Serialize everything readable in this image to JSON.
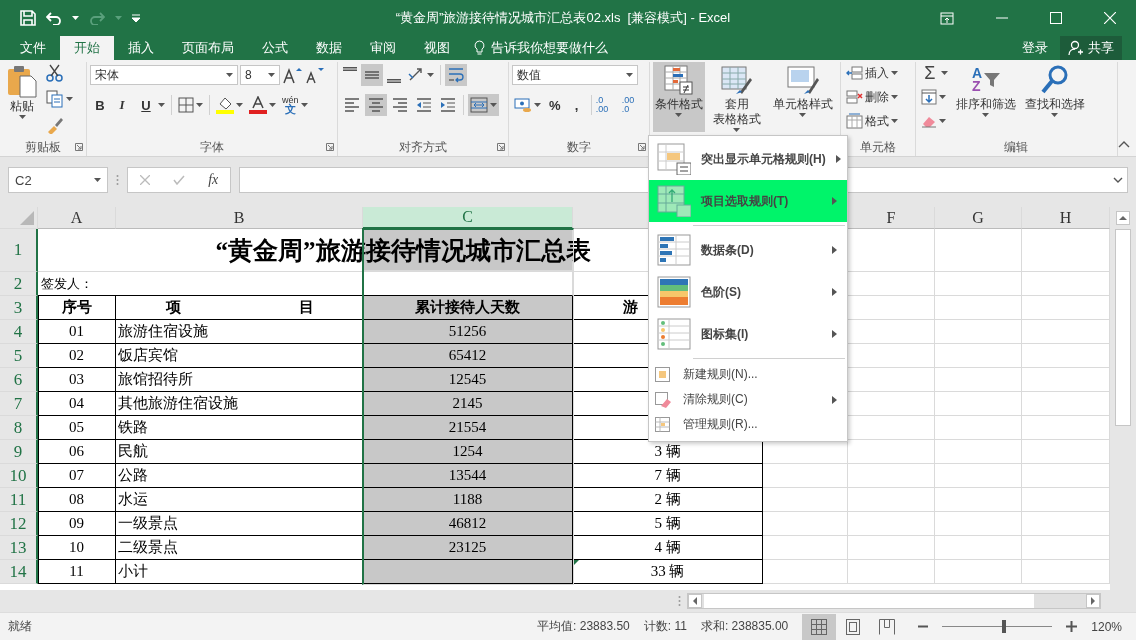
{
  "title_bar": {
    "title": "“黄金周”旅游接待情况城市汇总表02.xls  [兼容模式] - Excel",
    "redo_disabled": true
  },
  "tabs": [
    {
      "label": "文件",
      "selected": false
    },
    {
      "label": "开始",
      "selected": true
    },
    {
      "label": "插入",
      "selected": false
    },
    {
      "label": "页面布局",
      "selected": false
    },
    {
      "label": "公式",
      "selected": false
    },
    {
      "label": "数据",
      "selected": false
    },
    {
      "label": "审阅",
      "selected": false
    },
    {
      "label": "视图",
      "selected": false
    }
  ],
  "tell_me": "告诉我你想要做什么",
  "sign_in": "登录",
  "share": "共享",
  "ribbon": {
    "clipboard": {
      "label": "剪贴板",
      "paste": "粘贴",
      "launcher": true
    },
    "font": {
      "label": "字体",
      "name": "宋体",
      "size": "8",
      "bold": "B",
      "italic": "I",
      "underline": "U",
      "phonetic_top": "wén",
      "phonetic_bottom": "文",
      "launcher": true
    },
    "alignment": {
      "label": "对齐方式",
      "launcher": true,
      "row1": [
        {
          "kind": "top",
          "pressed": false
        },
        {
          "kind": "middle",
          "pressed": true
        },
        {
          "kind": "bottom",
          "pressed": false
        },
        {
          "kind": "orientation",
          "pressed": false
        },
        {
          "kind": "wrap",
          "pressed": true
        }
      ],
      "row2": [
        {
          "kind": "left",
          "pressed": false
        },
        {
          "kind": "center",
          "pressed": true
        },
        {
          "kind": "right",
          "pressed": false
        },
        {
          "kind": "outdent",
          "pressed": false
        },
        {
          "kind": "indent",
          "pressed": false
        },
        {
          "kind": "merge",
          "pressed": true
        }
      ]
    },
    "number": {
      "label": "数字",
      "format": "数值",
      "percent": "%",
      "comma": ",",
      "increase_decimal": [
        ".0",
        ".00"
      ],
      "decrease_decimal": [
        ".00",
        ".0"
      ],
      "launcher": true
    },
    "styles": {
      "buttons": [
        {
          "kind": "conditional",
          "lines": [
            "条件格式"
          ],
          "pressed": true
        },
        {
          "kind": "table",
          "lines": [
            "套用",
            "表格格式"
          ],
          "pressed": false
        },
        {
          "kind": "cellstyle",
          "lines": [
            "单元格样式"
          ],
          "pressed": false
        }
      ]
    },
    "cells": {
      "label": "单元格",
      "items": [
        {
          "kind": "insert",
          "label": "插入"
        },
        {
          "kind": "delete",
          "label": "删除"
        },
        {
          "kind": "format",
          "label": "格式"
        }
      ]
    },
    "editing": {
      "label": "编辑",
      "autosum": "Σ",
      "sort": "排序和筛选",
      "sort_letters": [
        "A",
        "Z"
      ],
      "find": "查找和选择"
    }
  },
  "formula_bar": {
    "name_box": "C2",
    "function_label": "fx"
  },
  "columns": [
    {
      "kind": "letter",
      "label": "A",
      "selected": false
    },
    {
      "kind": "letter",
      "label": "B",
      "selected": false
    },
    {
      "kind": "letter",
      "label": "C",
      "selected": true
    },
    {
      "kind": "covered"
    },
    {
      "kind": "covered"
    },
    {
      "kind": "letter",
      "label": "F",
      "selected": false
    },
    {
      "kind": "letter",
      "label": "G",
      "selected": false
    },
    {
      "kind": "letter",
      "label": "H",
      "selected": false
    }
  ],
  "rows": [
    {
      "number": "1",
      "selected": true,
      "kind": "title",
      "text": "“黄金周”旅游接待情况城市汇总表"
    },
    {
      "number": "2",
      "selected": true,
      "kind": "note",
      "text": "签发人："
    },
    {
      "number": "3",
      "selected": true,
      "kind": "header",
      "seq": "序号",
      "item": "项 目",
      "days": "累计接待人天数",
      "vehicles": "游"
    },
    {
      "number": "4",
      "selected": true,
      "kind": "data",
      "seq": "01",
      "item": "旅游住宿设施",
      "days": "51256",
      "error_mark": false
    },
    {
      "number": "5",
      "selected": true,
      "kind": "data",
      "seq": "02",
      "item": "饭店宾馆",
      "days": "65412",
      "error_mark": false
    },
    {
      "number": "6",
      "selected": true,
      "kind": "data",
      "seq": "03",
      "item": "旅馆招待所",
      "days": "12545",
      "error_mark": false
    },
    {
      "number": "7",
      "selected": true,
      "kind": "data",
      "seq": "04",
      "item": "其他旅游住宿设施",
      "days": "2145",
      "error_mark": false
    },
    {
      "number": "8",
      "selected": true,
      "kind": "data",
      "seq": "05",
      "item": "铁路",
      "days": "21554",
      "error_mark": false
    },
    {
      "number": "9",
      "selected": true,
      "kind": "data",
      "seq": "06",
      "item": "民航",
      "days": "1254",
      "vehicles": "3 辆",
      "error_mark": false
    },
    {
      "number": "10",
      "selected": true,
      "kind": "data",
      "seq": "07",
      "item": "公路",
      "days": "13544",
      "vehicles": "7 辆",
      "error_mark": false
    },
    {
      "number": "11",
      "selected": true,
      "kind": "data",
      "seq": "08",
      "item": "水运",
      "days": "1188",
      "vehicles": "2 辆",
      "error_mark": false
    },
    {
      "number": "12",
      "selected": true,
      "kind": "data",
      "seq": "09",
      "item": "一级景点",
      "days": "46812",
      "vehicles": "5 辆",
      "error_mark": false
    },
    {
      "number": "13",
      "selected": true,
      "kind": "data",
      "seq": "10",
      "item": "二级景点",
      "days": "23125",
      "vehicles": "4 辆",
      "error_mark": false
    },
    {
      "number": "14",
      "selected": true,
      "kind": "data",
      "seq": "11",
      "item": "小计",
      "vehicles": "33 辆",
      "error_mark": true
    }
  ],
  "menu": {
    "items": [
      {
        "kind": "large",
        "label": "突出显示单元格规则(H)",
        "submenu": true,
        "selected": false,
        "divider_above": false
      },
      {
        "kind": "large",
        "label": "项目选取规则(T)",
        "submenu": true,
        "selected": true,
        "divider_above": false
      },
      {
        "kind": "large",
        "label": "数据条(D)",
        "submenu": true,
        "selected": false,
        "divider_above": true
      },
      {
        "kind": "large",
        "label": "色阶(S)",
        "submenu": true,
        "selected": false,
        "divider_above": false
      },
      {
        "kind": "large",
        "label": "图标集(I)",
        "submenu": true,
        "selected": false,
        "divider_above": false
      },
      {
        "kind": "small",
        "label": "新建规则(N)...",
        "submenu": false,
        "selected": false,
        "divider_above": true
      },
      {
        "kind": "small",
        "label": "清除规则(C)",
        "submenu": true,
        "selected": false,
        "divider_above": false
      },
      {
        "kind": "small",
        "label": "管理规则(R)...",
        "submenu": false,
        "selected": false,
        "divider_above": false
      }
    ]
  },
  "status_bar": {
    "ready": "就绪",
    "average": "平均值: 23883.50",
    "count": "计数: 11",
    "sum": "求和: 238835.00",
    "views": [
      {
        "kind": "normal",
        "selected": true
      },
      {
        "kind": "page_layout",
        "selected": false
      },
      {
        "kind": "page_break",
        "selected": false
      }
    ],
    "zoom": {
      "level": 0.56,
      "reading": "120%"
    }
  }
}
